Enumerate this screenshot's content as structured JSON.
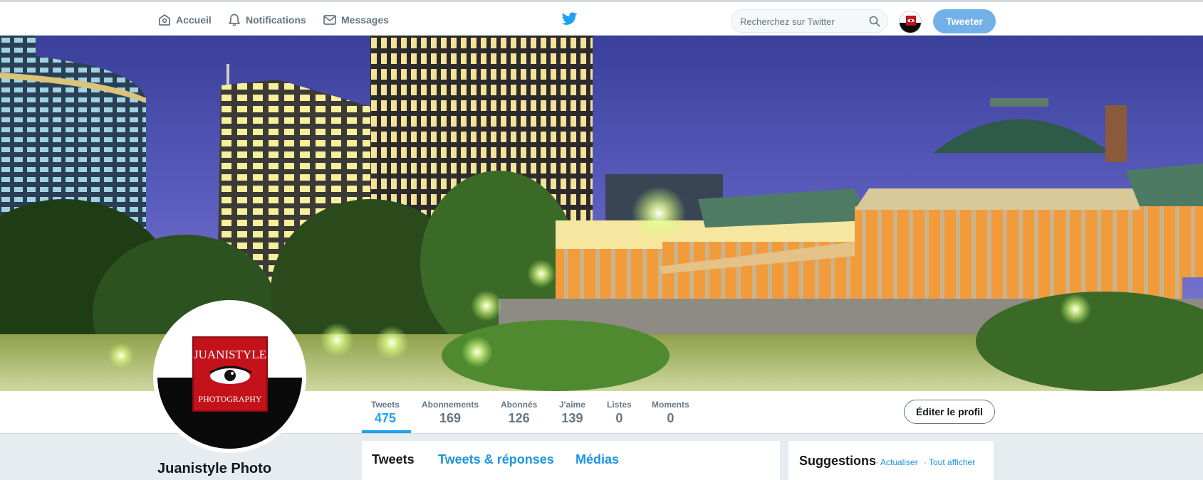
{
  "nav": {
    "home_label": "Accueil",
    "notifications_label": "Notifications",
    "messages_label": "Messages",
    "search_placeholder": "Recherchez sur Twitter",
    "tweet_button": "Tweeter"
  },
  "profile": {
    "display_name": "Juanistyle Photo",
    "avatar_text_top": "JUANISTYLE",
    "avatar_text_bottom": "PHOTOGRAPHY"
  },
  "stats": [
    {
      "label": "Tweets",
      "value": "475"
    },
    {
      "label": "Abonnements",
      "value": "169"
    },
    {
      "label": "Abonnés",
      "value": "126"
    },
    {
      "label": "J'aime",
      "value": "139"
    },
    {
      "label": "Listes",
      "value": "0"
    },
    {
      "label": "Moments",
      "value": "0"
    }
  ],
  "edit_profile": "Éditer le profil",
  "timeline_tabs": [
    "Tweets",
    "Tweets & réponses",
    "Médias"
  ],
  "suggestions": {
    "title": "Suggestions",
    "refresh": "Actualiser",
    "view_all": "Tout afficher"
  },
  "colors": {
    "accent": "#1da1f2",
    "tweet_button": "#71b1e8",
    "logo_red": "#c4121a"
  },
  "icons": [
    "home-icon",
    "bell-icon",
    "envelope-icon",
    "twitter-bird-icon",
    "search-icon"
  ]
}
